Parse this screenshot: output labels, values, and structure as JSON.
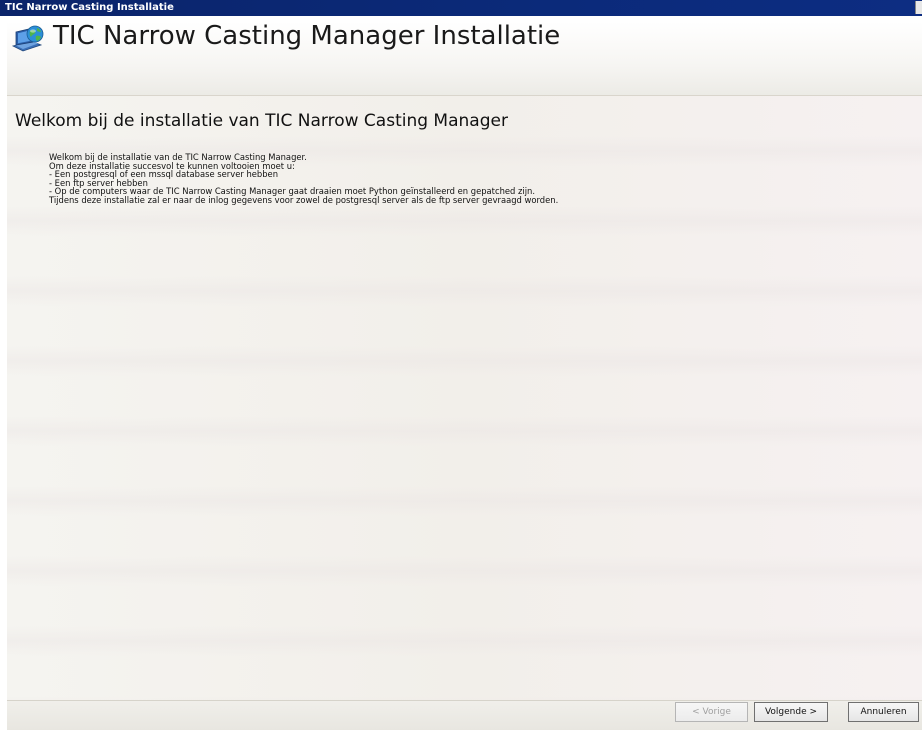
{
  "window": {
    "title": "TIC Narrow Casting Installatie"
  },
  "header": {
    "icon": "computer-globe-icon",
    "title": "TIC Narrow Casting Manager Installatie"
  },
  "main": {
    "heading": "Welkom bij de installatie van TIC Narrow Casting Manager",
    "lines": [
      "Welkom bij de installatie van de TIC Narrow Casting Manager.",
      "Om deze installatie succesvol te kunnen voltooien moet u:",
      "- Een postgresql of een mssql database server hebben",
      "- Een ftp server hebben",
      "- Op de computers waar de TIC Narrow Casting Manager gaat draaien moet Python geïnstalleerd en gepatched zijn.",
      "Tijdens deze installatie zal er naar de inlog gegevens voor zowel de postgresql server als de ftp server gevraagd worden."
    ]
  },
  "footer": {
    "prev_label": "< Vorige",
    "next_label": "Volgende >",
    "cancel_label": "Annuleren"
  }
}
